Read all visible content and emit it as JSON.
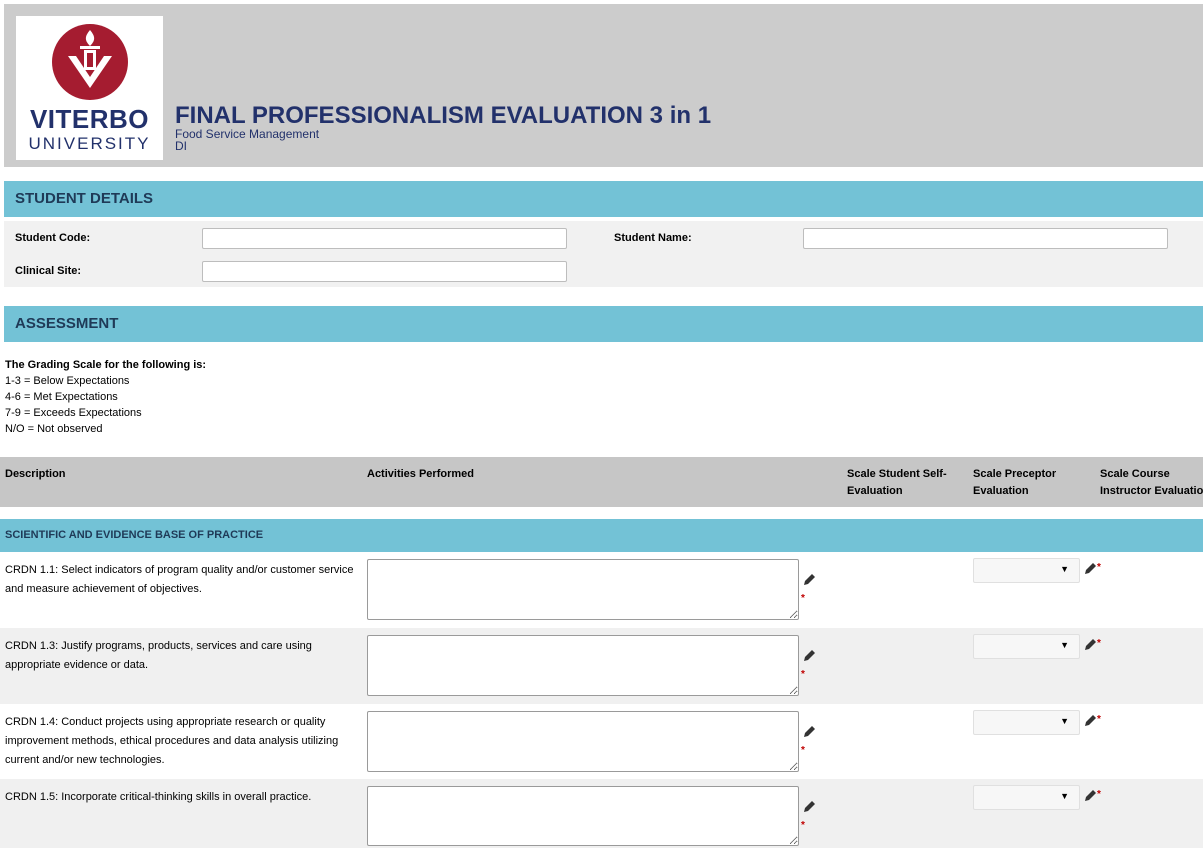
{
  "header": {
    "logo_word": "VITERBO",
    "logo_sub": "UNIVERSITY",
    "title": "FINAL PROFESSIONALISM EVALUATION 3 in 1",
    "subtitle_line1": "Food Service Management",
    "subtitle_line2": "DI",
    "logo_color": "#a51c30",
    "brand_color": "#22316b"
  },
  "student_details": {
    "heading": "STUDENT DETAILS",
    "student_code_label": "Student Code:",
    "student_code_value": "",
    "student_name_label": "Student Name:",
    "student_name_value": "",
    "clinical_site_label": "Clinical Site:",
    "clinical_site_value": ""
  },
  "assessment": {
    "heading": "ASSESSMENT",
    "scale_heading": "The Grading Scale for the following is:",
    "scale_lines": [
      "1-3 = Below Expectations",
      "4-6 = Met Expectations",
      "7-9 = Exceeds Expectations",
      "N/O = Not observed"
    ]
  },
  "table": {
    "headers": {
      "description": "Description",
      "activities": "Activities Performed",
      "self_eval_line1": "Scale Student Self-",
      "self_eval_line2": "Evaluation",
      "preceptor_line1": "Scale Preceptor",
      "preceptor_line2": "Evaluation",
      "instructor_line1": "Scale Course",
      "instructor_line2": "Instructor Evaluation"
    },
    "category": "SCIENTIFIC AND EVIDENCE BASE OF PRACTICE",
    "rows": [
      {
        "description": "CRDN 1.1: Select indicators of program quality and/or customer service and measure achievement of objectives.",
        "activity": "",
        "preceptor_selected": ""
      },
      {
        "description": "CRDN 1.3: Justify programs, products, services and care using appropriate evidence or data.",
        "activity": "",
        "preceptor_selected": ""
      },
      {
        "description": "CRDN 1.4: Conduct projects using appropriate research or quality improvement methods, ethical procedures and data analysis utilizing current and/or new technologies.",
        "activity": "",
        "preceptor_selected": ""
      },
      {
        "description": "CRDN 1.5: Incorporate critical-thinking skills in overall practice.",
        "activity": "",
        "preceptor_selected": ""
      }
    ],
    "required_marker": "*",
    "dropdown_arrow": "▼"
  },
  "colors": {
    "section_bar": "#73c2d6",
    "header_bg": "#cccccc",
    "table_head_bg": "#c6c6c6",
    "required": "#c00000"
  },
  "icons": [
    "viterbo-shield-icon",
    "pencil-icon",
    "resize-grip-icon",
    "dropdown-arrow-icon"
  ]
}
